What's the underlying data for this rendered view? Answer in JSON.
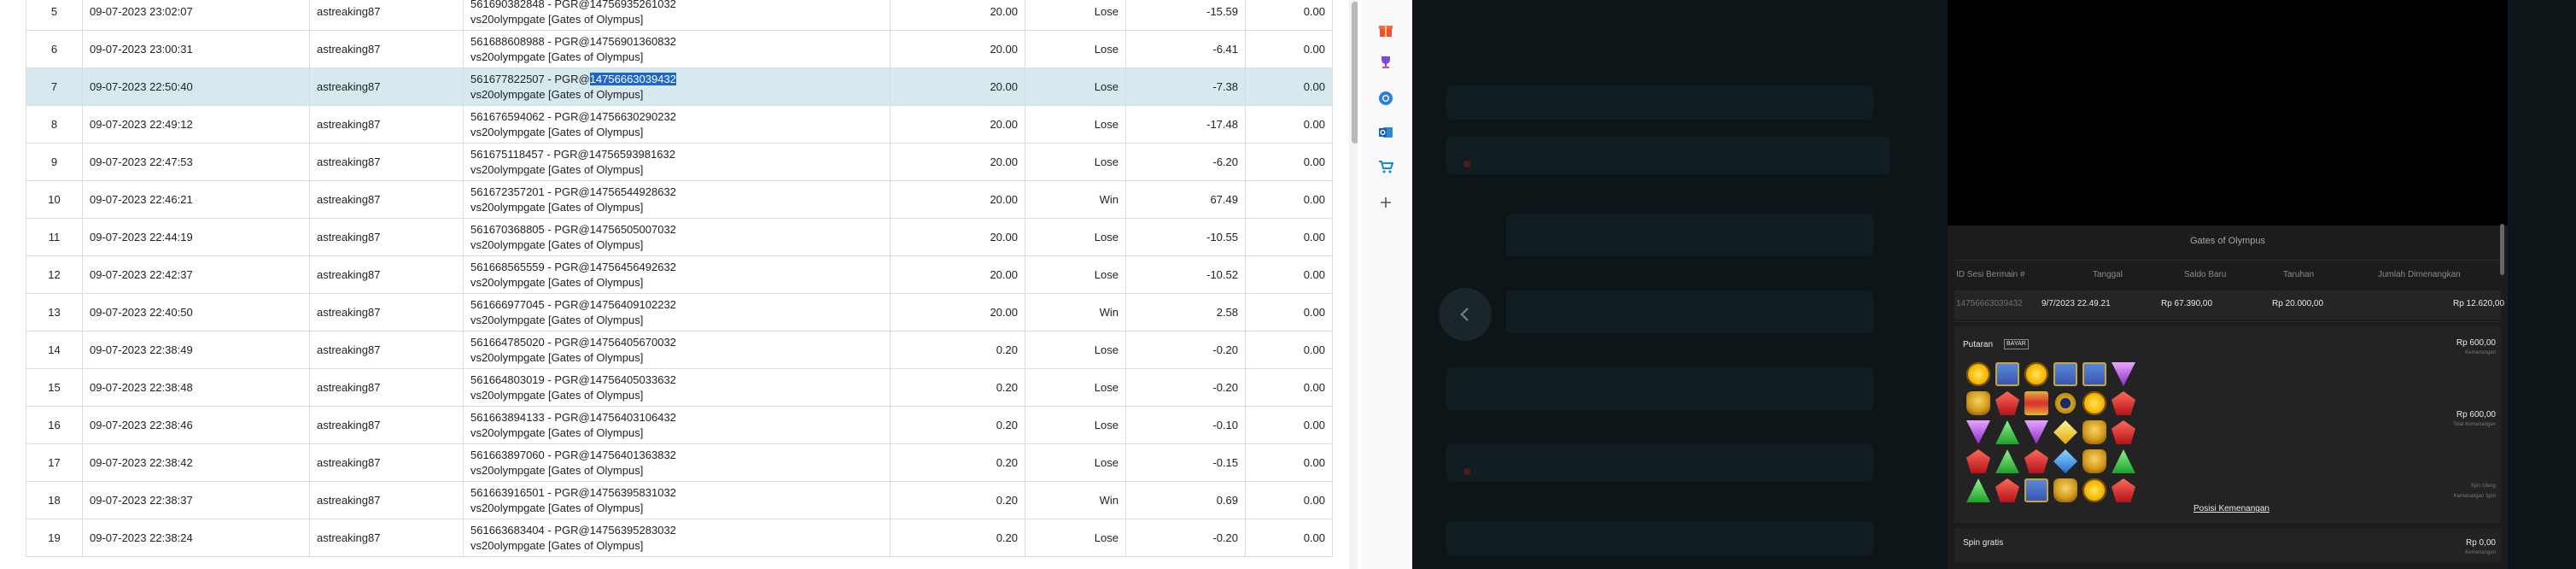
{
  "report": {
    "rows": [
      {
        "no": "5",
        "date": "09-07-2023 23:02:07",
        "user": "astreaking87",
        "ref_line1": "561690382848 - PGR@14756935261032",
        "ref_line2": "vs20olympgate [Gates of Olympus]",
        "bet": "20.00",
        "result": "Lose",
        "amount": "-15.59",
        "extra": "0.00"
      },
      {
        "no": "6",
        "date": "09-07-2023 23:00:31",
        "user": "astreaking87",
        "ref_line1": "561688608988 - PGR@14756901360832",
        "ref_line2": "vs20olympgate [Gates of Olympus]",
        "bet": "20.00",
        "result": "Lose",
        "amount": "-6.41",
        "extra": "0.00"
      },
      {
        "no": "7",
        "date": "09-07-2023 22:50:40",
        "user": "astreaking87",
        "ref_line1_a": "561677822507 - PGR@",
        "ref_line1_b": "14756663039432",
        "ref_line2": "vs20olympgate [Gates of Olympus]",
        "bet": "20.00",
        "result": "Lose",
        "amount": "-7.38",
        "extra": "0.00"
      },
      {
        "no": "8",
        "date": "09-07-2023 22:49:12",
        "user": "astreaking87",
        "ref_line1": "561676594062 - PGR@14756630290232",
        "ref_line2": "vs20olympgate [Gates of Olympus]",
        "bet": "20.00",
        "result": "Lose",
        "amount": "-17.48",
        "extra": "0.00"
      },
      {
        "no": "9",
        "date": "09-07-2023 22:47:53",
        "user": "astreaking87",
        "ref_line1": "561675118457 - PGR@14756593981632",
        "ref_line2": "vs20olympgate [Gates of Olympus]",
        "bet": "20.00",
        "result": "Lose",
        "amount": "-6.20",
        "extra": "0.00"
      },
      {
        "no": "10",
        "date": "09-07-2023 22:46:21",
        "user": "astreaking87",
        "ref_line1": "561672357201 - PGR@14756544928632",
        "ref_line2": "vs20olympgate [Gates of Olympus]",
        "bet": "20.00",
        "result": "Win",
        "amount": "67.49",
        "extra": "0.00"
      },
      {
        "no": "11",
        "date": "09-07-2023 22:44:19",
        "user": "astreaking87",
        "ref_line1": "561670368805 - PGR@14756505007032",
        "ref_line2": "vs20olympgate [Gates of Olympus]",
        "bet": "20.00",
        "result": "Lose",
        "amount": "-10.55",
        "extra": "0.00"
      },
      {
        "no": "12",
        "date": "09-07-2023 22:42:37",
        "user": "astreaking87",
        "ref_line1": "561668565559 - PGR@14756456492632",
        "ref_line2": "vs20olympgate [Gates of Olympus]",
        "bet": "20.00",
        "result": "Lose",
        "amount": "-10.52",
        "extra": "0.00"
      },
      {
        "no": "13",
        "date": "09-07-2023 22:40:50",
        "user": "astreaking87",
        "ref_line1": "561666977045 - PGR@14756409102232",
        "ref_line2": "vs20olympgate [Gates of Olympus]",
        "bet": "20.00",
        "result": "Win",
        "amount": "2.58",
        "extra": "0.00"
      },
      {
        "no": "14",
        "date": "09-07-2023 22:38:49",
        "user": "astreaking87",
        "ref_line1": "561664785020 - PGR@14756405670032",
        "ref_line2": "vs20olympgate [Gates of Olympus]",
        "bet": "0.20",
        "result": "Lose",
        "amount": "-0.20",
        "extra": "0.00"
      },
      {
        "no": "15",
        "date": "09-07-2023 22:38:48",
        "user": "astreaking87",
        "ref_line1": "561664803019 - PGR@14756405033632",
        "ref_line2": "vs20olympgate [Gates of Olympus]",
        "bet": "0.20",
        "result": "Lose",
        "amount": "-0.20",
        "extra": "0.00"
      },
      {
        "no": "16",
        "date": "09-07-2023 22:38:46",
        "user": "astreaking87",
        "ref_line1": "561663894133 - PGR@14756403106432",
        "ref_line2": "vs20olympgate [Gates of Olympus]",
        "bet": "0.20",
        "result": "Lose",
        "amount": "-0.10",
        "extra": "0.00"
      },
      {
        "no": "17",
        "date": "09-07-2023 22:38:42",
        "user": "astreaking87",
        "ref_line1": "561663897060 - PGR@14756401363832",
        "ref_line2": "vs20olympgate [Gates of Olympus]",
        "bet": "0.20",
        "result": "Lose",
        "amount": "-0.15",
        "extra": "0.00"
      },
      {
        "no": "18",
        "date": "09-07-2023 22:38:37",
        "user": "astreaking87",
        "ref_line1": "561663916501 - PGR@14756395831032",
        "ref_line2": "vs20olympgate [Gates of Olympus]",
        "bet": "0.20",
        "result": "Win",
        "amount": "0.69",
        "extra": "0.00"
      },
      {
        "no": "19",
        "date": "09-07-2023 22:38:24",
        "user": "astreaking87",
        "ref_line1": "561663683404 - PGR@14756395283032",
        "ref_line2": "vs20olympgate [Gates of Olympus]",
        "bet": "0.20",
        "result": "Lose",
        "amount": "-0.20",
        "extra": "0.00"
      }
    ]
  },
  "sidebar": {
    "icons": [
      "gift-icon",
      "trophy-icon",
      "chrome-icon",
      "outlook-icon",
      "shopping-cart-icon",
      "plus-icon"
    ]
  },
  "history": {
    "title": "Gates of Olympus",
    "columns": {
      "id": "ID Sesi Bermain #",
      "date": "Tanggal",
      "balance": "Saldo Baru",
      "bet": "Taruhan",
      "win": "Jumlah Dimenangkan"
    },
    "row": {
      "id": "14756663039432",
      "date": "9/7/2023 22.49.21",
      "balance": "Rp 67.390,00",
      "bet": "Rp 20.000,00",
      "win": "Rp 12.620,00"
    },
    "round": {
      "label": "Putaran",
      "badge": "BAYAR",
      "amount": "Rp 600,00",
      "sub": "Kemenangan",
      "amount2": "Rp 600,00",
      "sub2": "Total Kemenangan",
      "sub3": "Spin Ulang",
      "sub4": "Kemenangan Spin",
      "win_positions_link": "Posisi Kemenangan",
      "grid": [
        [
          "sun",
          "crown",
          "sun",
          "crown",
          "crown",
          "purple"
        ],
        [
          "chalice",
          "red",
          "hourglass",
          "ring",
          "sun",
          "red"
        ],
        [
          "purple",
          "green",
          "purple",
          "yellow",
          "chalice",
          "red"
        ],
        [
          "red",
          "green",
          "red",
          "blue",
          "chalice",
          "green"
        ],
        [
          "green",
          "red",
          "crown",
          "chalice",
          "sun",
          "red"
        ]
      ]
    },
    "free_spins": {
      "label": "Spin gratis",
      "amount": "Rp 0,00",
      "sub": "Kemenangan"
    }
  },
  "colors": {
    "lose": "#d9302c",
    "win": "#2e9b2e",
    "selected_row": "#d5e9ef",
    "selection_highlight": "#1e66d0",
    "game_bg": "#0c1518"
  }
}
